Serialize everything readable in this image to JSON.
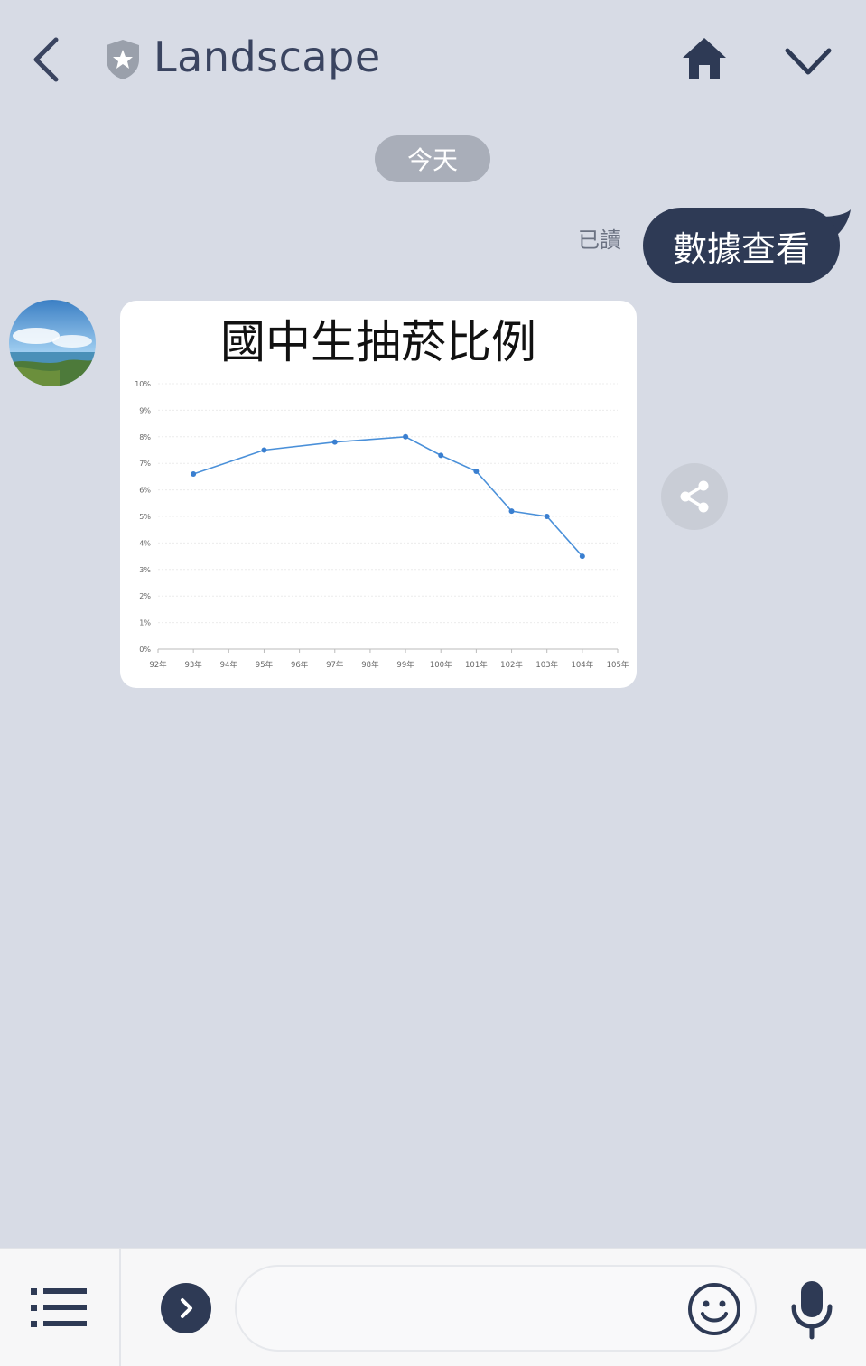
{
  "header": {
    "title": "Landscape",
    "icons": [
      "back-icon",
      "shield-star-icon",
      "home-icon",
      "chevron-down-icon"
    ]
  },
  "chat": {
    "date_label": "今天",
    "outgoing": {
      "read_label": "已讀",
      "text": "數據查看"
    }
  },
  "chart_data": {
    "type": "line",
    "title": "國中生抽菸比例",
    "categories": [
      "92年",
      "93年",
      "94年",
      "95年",
      "96年",
      "97年",
      "98年",
      "99年",
      "100年",
      "101年",
      "102年",
      "103年",
      "104年",
      "105年"
    ],
    "x": [
      "93年",
      "95年",
      "97年",
      "99年",
      "100年",
      "101年",
      "102年",
      "103年",
      "104年"
    ],
    "values": [
      6.6,
      7.5,
      7.8,
      8.0,
      7.3,
      6.7,
      5.2,
      5.0,
      3.5
    ],
    "yticks": [
      "0%",
      "1%",
      "2%",
      "3%",
      "4%",
      "5%",
      "6%",
      "7%",
      "8%",
      "9%",
      "10%"
    ],
    "ylim": [
      0,
      10
    ],
    "grid": true,
    "legend": "none",
    "line_color": "#4a90d9"
  },
  "composer": {
    "placeholder": "",
    "icons": [
      "menu-icon",
      "chevron-right-icon",
      "emoji-icon",
      "microphone-icon"
    ]
  },
  "colors": {
    "background": "#d7dbe5",
    "bubble": "#2e3a55",
    "accent": "#2e3a55"
  }
}
